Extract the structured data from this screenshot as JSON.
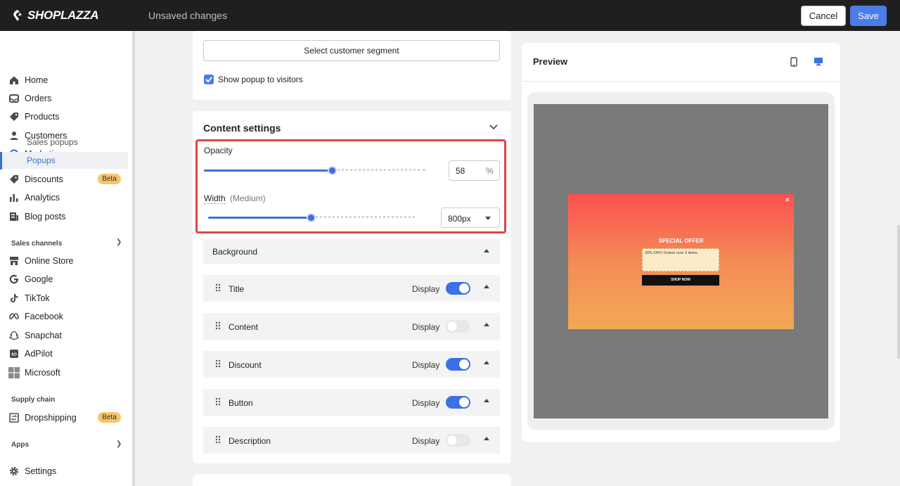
{
  "topbar": {
    "logo_text": "SHOPLAZZA",
    "status": "Unsaved changes",
    "cancel_label": "Cancel",
    "save_label": "Save"
  },
  "sidebar": {
    "items": [
      {
        "label": "Home",
        "icon": "home-icon"
      },
      {
        "label": "Orders",
        "icon": "inbox-icon"
      },
      {
        "label": "Products",
        "icon": "tag-icon"
      },
      {
        "label": "Customers",
        "icon": "person-icon"
      },
      {
        "label": "Marketing",
        "icon": "target-icon"
      },
      {
        "label": "Discounts",
        "icon": "discount-tag-icon"
      },
      {
        "label": "Analytics",
        "icon": "bar-chart-icon"
      },
      {
        "label": "Blog posts",
        "icon": "document-icon"
      }
    ],
    "marketing_sub": [
      {
        "label": "Sales popups"
      },
      {
        "label": "Popups",
        "active": true
      }
    ],
    "discounts_badge": "Beta",
    "sales_channels_heading": "Sales channels",
    "channels": [
      {
        "label": "Online Store",
        "icon": "store-icon"
      },
      {
        "label": "Google",
        "icon": "google-icon"
      },
      {
        "label": "TikTok",
        "icon": "tiktok-icon"
      },
      {
        "label": "Facebook",
        "icon": "meta-icon"
      },
      {
        "label": "Snapchat",
        "icon": "snapchat-icon"
      },
      {
        "label": "AdPilot",
        "icon": "ad-icon"
      },
      {
        "label": "Microsoft",
        "icon": "microsoft-icon"
      }
    ],
    "supply_chain_heading": "Supply chain",
    "dropshipping_label": "Dropshipping",
    "dropshipping_badge": "Beta",
    "apps_heading": "Apps",
    "settings_label": "Settings"
  },
  "targeting": {
    "segment_button": "Select customer segment",
    "show_popup_label": "Show popup to visitors",
    "show_popup_checked": true
  },
  "content_settings": {
    "title": "Content settings",
    "opacity_label": "Opacity",
    "opacity_value": "58",
    "opacity_unit": "%",
    "width_label": "Width",
    "width_hint": "(Medium)",
    "width_value": "800px",
    "background_label": "Background",
    "display_label": "Display",
    "elements": [
      {
        "name": "Title",
        "display": true
      },
      {
        "name": "Content",
        "display": false
      },
      {
        "name": "Discount",
        "display": true
      },
      {
        "name": "Button",
        "display": true
      },
      {
        "name": "Description",
        "display": false
      }
    ]
  },
  "preview": {
    "title": "Preview",
    "popup": {
      "title": "SPECIAL OFFER",
      "coupon_text": "20% OFF/ Orders over 3 items",
      "button_text": "SHOP NOW"
    }
  },
  "colors": {
    "accent": "#4c7bea",
    "highlight_border": "#e04545",
    "topbar": "#1f1f1f"
  }
}
